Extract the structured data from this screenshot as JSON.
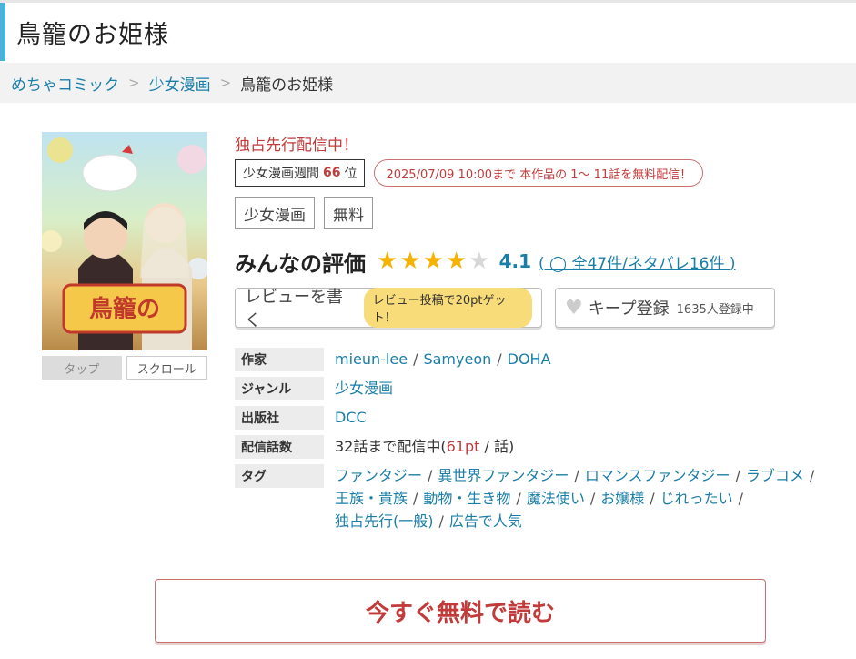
{
  "page_title": "鳥籠のお姫様",
  "breadcrumb": [
    {
      "label": "めちゃコミック"
    },
    {
      "label": "少女漫画"
    },
    {
      "label": "鳥籠のお姫様"
    }
  ],
  "cover": {
    "title_art": "鳥籠のお姫様",
    "tap_label": "タップ",
    "scroll_label": "スクロール"
  },
  "exclusive_label": "独占先行配信中！",
  "rank": {
    "prefix": "少女漫画週間",
    "number": "66",
    "suffix": "位"
  },
  "free_note": "2025/07/09 10:00まで 本作品の 1〜 11話を無料配信！",
  "category_chips": [
    "少女漫画",
    "無料"
  ],
  "rating": {
    "label": "みんなの評価",
    "score": "4.1",
    "stars_filled": 4,
    "stars_total": 5,
    "counts_text": "( ◯ 全47件/ネタバレ16件 )"
  },
  "review_button": {
    "label": "レビューを書く",
    "badge": "レビュー投稿で20ptゲット！"
  },
  "keep_button": {
    "label": "キープ登録",
    "count": "1635人登録中"
  },
  "details": {
    "author_label": "作家",
    "authors": [
      "mieun-lee",
      "Samyeon",
      "DOHA"
    ],
    "genre_label": "ジャンル",
    "genre": "少女漫画",
    "publisher_label": "出版社",
    "publisher": "DCC",
    "episodes_label": "配信話数",
    "episodes_prefix": "32話まで配信中(",
    "episodes_pt": "61pt",
    "episodes_suffix": " / 話)",
    "tags_label": "タグ",
    "tags_line1": [
      "ファンタジー",
      "異世界ファンタジー",
      "ロマンスファンタジー",
      "ラブコメ"
    ],
    "tags_line2": [
      "王族・貴族",
      "動物・生き物",
      "魔法使い",
      "お嬢様",
      "じれったい"
    ],
    "tags_line3": [
      "独占先行(一般)",
      "広告で人気"
    ]
  },
  "read_button": "今すぐ無料で読む",
  "colors": {
    "accent_blue": "#1a7ea8",
    "accent_red": "#c23b3b",
    "title_bar": "#4bb3d9",
    "star": "#f5b300"
  }
}
